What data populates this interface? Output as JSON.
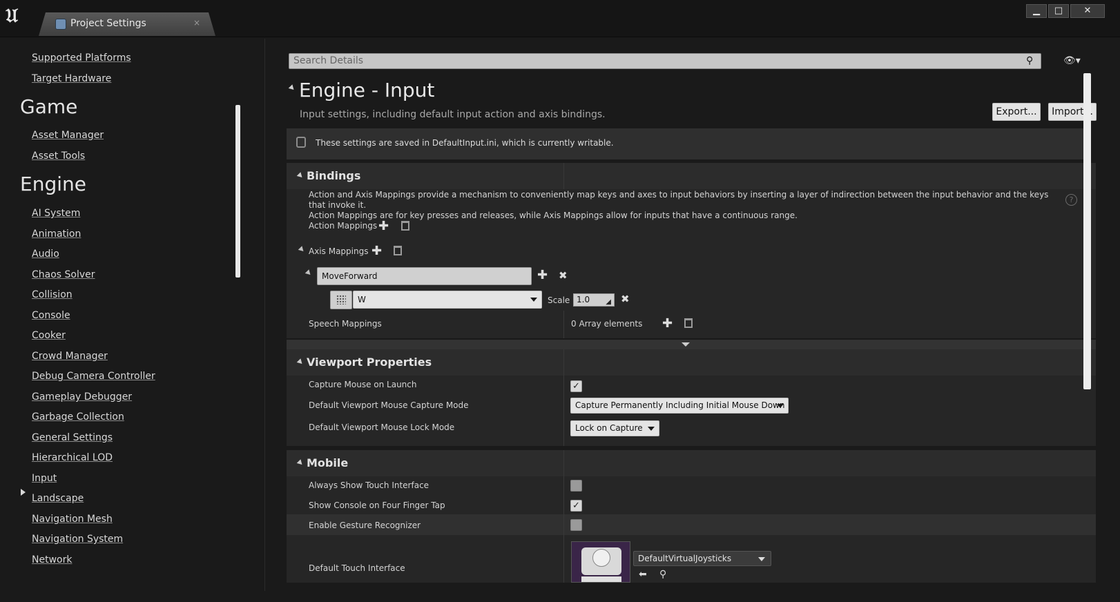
{
  "window": {
    "tab_title": "Project Settings",
    "tab_close": "×",
    "btn_minimize": "▁",
    "btn_maximize": "□",
    "btn_close": "✕"
  },
  "sidebar": {
    "top_items": [
      "Supported Platforms",
      "Target Hardware"
    ],
    "game": {
      "heading": "Game",
      "items": [
        "Asset Manager",
        "Asset Tools"
      ]
    },
    "engine": {
      "heading": "Engine",
      "items": [
        "AI System",
        "Animation",
        "Audio",
        "Chaos Solver",
        "Collision",
        "Console",
        "Cooker",
        "Crowd Manager",
        "Debug Camera Controller",
        "Gameplay Debugger",
        "Garbage Collection",
        "General Settings",
        "Hierarchical LOD",
        "Input",
        "Landscape",
        "Navigation Mesh",
        "Navigation System",
        "Network"
      ]
    },
    "selected": "Input"
  },
  "search": {
    "placeholder": "Search Details"
  },
  "header": {
    "title": "Engine - Input",
    "subtitle": "Input settings, including default input action and axis bindings.",
    "export_label": "Export...",
    "import_label": "Import..."
  },
  "notice": {
    "text": "These settings are saved in DefaultInput.ini, which is currently writable."
  },
  "bindings": {
    "heading": "Bindings",
    "description_line1": "Action and Axis Mappings provide a mechanism to conveniently map keys and axes to input behaviors by inserting a layer of indirection between the input behavior and the keys that invoke it.",
    "description_line2": "Action Mappings are for key presses and releases, while Axis Mappings allow for inputs that have a continuous range.",
    "action_mappings_label": "Action Mappings",
    "axis_mappings_label": "Axis Mappings",
    "axis_name": "MoveForward",
    "key_value": "W",
    "scale_label": "Scale",
    "scale_value": "1.0",
    "speech_mappings_label": "Speech Mappings",
    "speech_mappings_value": "0 Array elements"
  },
  "viewport": {
    "heading": "Viewport Properties",
    "capture_mouse_label": "Capture Mouse on Launch",
    "capture_mouse_checked": true,
    "capture_mode_label": "Default Viewport Mouse Capture Mode",
    "capture_mode_value": "Capture Permanently Including Initial Mouse Down",
    "lock_mode_label": "Default Viewport Mouse Lock Mode",
    "lock_mode_value": "Lock on Capture"
  },
  "mobile": {
    "heading": "Mobile",
    "always_touch_label": "Always Show Touch Interface",
    "always_touch_checked": false,
    "console_four_finger_label": "Show Console on Four Finger Tap",
    "console_four_finger_checked": true,
    "gesture_label": "Enable Gesture Recognizer",
    "gesture_checked": false,
    "touch_interface_label": "Default Touch Interface",
    "touch_interface_value": "DefaultVirtualJoysticks"
  },
  "icons": {
    "help": "?",
    "check": "✓",
    "plus": "✚",
    "x": "✖",
    "eye": "👁▾"
  }
}
